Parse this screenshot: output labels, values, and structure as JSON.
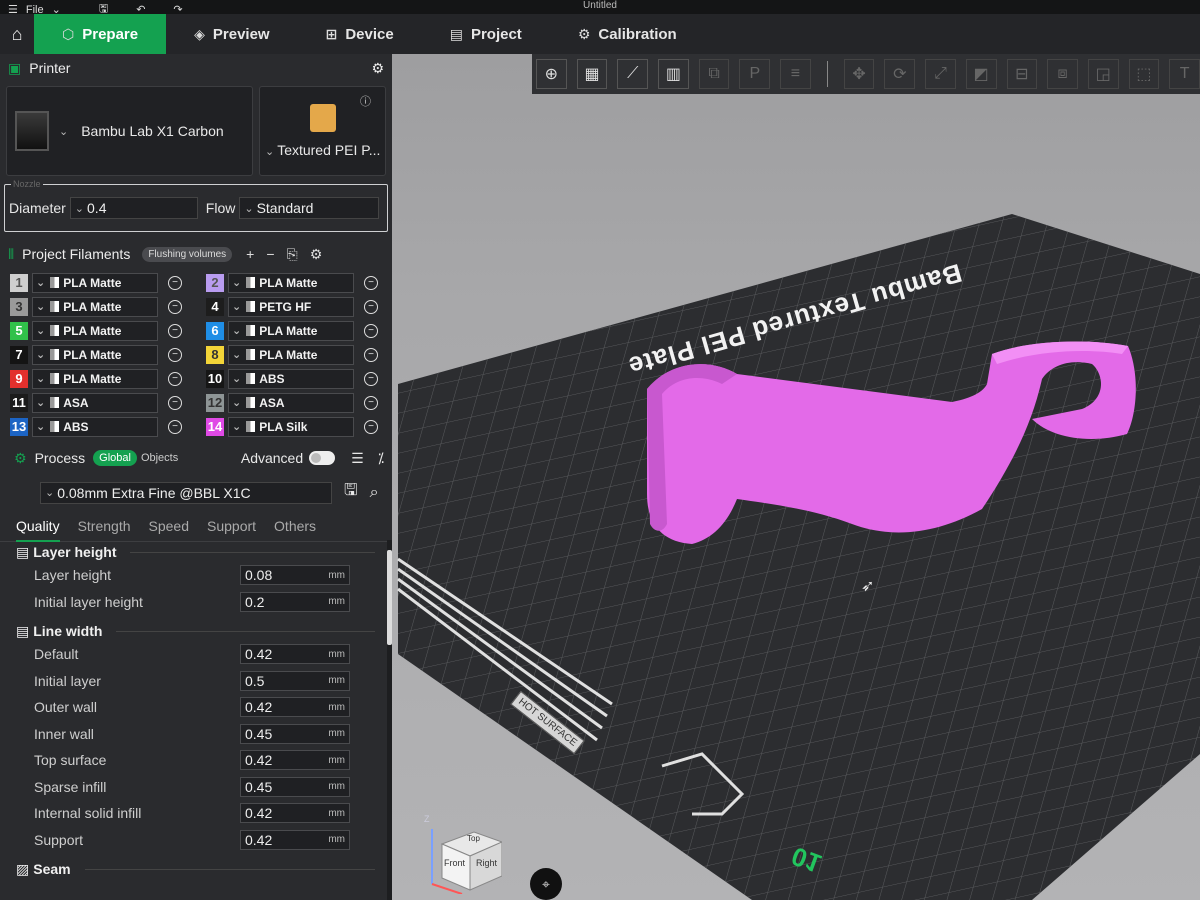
{
  "window": {
    "menu_label": "File",
    "title": "Untitled"
  },
  "nav": {
    "tabs": [
      {
        "label": "Prepare",
        "icon": "cube-icon"
      },
      {
        "label": "Preview",
        "icon": "layers-icon"
      },
      {
        "label": "Device",
        "icon": "device-icon"
      },
      {
        "label": "Project",
        "icon": "project-icon"
      },
      {
        "label": "Calibration",
        "icon": "calibration-icon"
      }
    ],
    "active_color": "#14a150"
  },
  "printer": {
    "section_title": "Printer",
    "name": "Bambu Lab X1 Carbon",
    "plate": "Textured PEI P...",
    "nozzle_legend": "Nozzle",
    "diameter_label": "Diameter",
    "diameter_value": "0.4",
    "flow_label": "Flow",
    "flow_value": "Standard"
  },
  "filaments": {
    "section_title": "Project Filaments",
    "flushing_label": "Flushing volumes",
    "items": [
      {
        "num": "1",
        "name": "PLA Matte",
        "color": "#cfcfcf",
        "text_color": "#555"
      },
      {
        "num": "2",
        "name": "PLA Matte",
        "color": "#b99cf0",
        "text_color": "#555"
      },
      {
        "num": "3",
        "name": "PLA Matte",
        "color": "#9a9a9a",
        "text_color": "#333"
      },
      {
        "num": "4",
        "name": "PETG HF",
        "color": "#1d1d1d",
        "text_color": "#fff"
      },
      {
        "num": "5",
        "name": "PLA Matte",
        "color": "#31c14a",
        "text_color": "#fff"
      },
      {
        "num": "6",
        "name": "PLA Matte",
        "color": "#1f8ee6",
        "text_color": "#fff"
      },
      {
        "num": "7",
        "name": "PLA Matte",
        "color": "#141414",
        "text_color": "#fff"
      },
      {
        "num": "8",
        "name": "PLA Matte",
        "color": "#f3d538",
        "text_color": "#333"
      },
      {
        "num": "9",
        "name": "PLA Matte",
        "color": "#e2302d",
        "text_color": "#fff"
      },
      {
        "num": "10",
        "name": "ABS",
        "color": "#161616",
        "text_color": "#fff"
      },
      {
        "num": "11",
        "name": "ASA",
        "color": "#1b1b1b",
        "text_color": "#fff"
      },
      {
        "num": "12",
        "name": "ASA",
        "color": "#8e9596",
        "text_color": "#333"
      },
      {
        "num": "13",
        "name": "ABS",
        "color": "#1c64c4",
        "text_color": "#fff"
      },
      {
        "num": "14",
        "name": "PLA Silk",
        "color": "#e04ae6",
        "text_color": "#fff"
      }
    ]
  },
  "process": {
    "section_title": "Process",
    "global_label": "Global",
    "objects_label": "Objects",
    "advanced_label": "Advanced",
    "preset": "0.08mm Extra Fine @BBL X1C",
    "tabs": [
      "Quality",
      "Strength",
      "Speed",
      "Support",
      "Others"
    ],
    "unit": "mm",
    "groups": [
      {
        "title": "Layer height",
        "icon": "layer-height-icon",
        "rows": [
          {
            "label": "Layer height",
            "value": "0.08"
          },
          {
            "label": "Initial layer height",
            "value": "0.2"
          }
        ]
      },
      {
        "title": "Line width",
        "icon": "line-width-icon",
        "rows": [
          {
            "label": "Default",
            "value": "0.42"
          },
          {
            "label": "Initial layer",
            "value": "0.5"
          },
          {
            "label": "Outer wall",
            "value": "0.42"
          },
          {
            "label": "Inner wall",
            "value": "0.45"
          },
          {
            "label": "Top surface",
            "value": "0.42"
          },
          {
            "label": "Sparse infill",
            "value": "0.45"
          },
          {
            "label": "Internal solid infill",
            "value": "0.42"
          },
          {
            "label": "Support",
            "value": "0.42"
          }
        ]
      }
    ],
    "next_group_title": "Seam"
  },
  "viewport": {
    "bed_text": "Bambu Textured PEI Plate",
    "plate_number": "01",
    "hot_surface": "HOT SURFACE",
    "model_color": "#e36ae8",
    "cube_faces": {
      "top": "Top",
      "front": "Front",
      "right": "Right"
    },
    "axis_z": "Z"
  }
}
